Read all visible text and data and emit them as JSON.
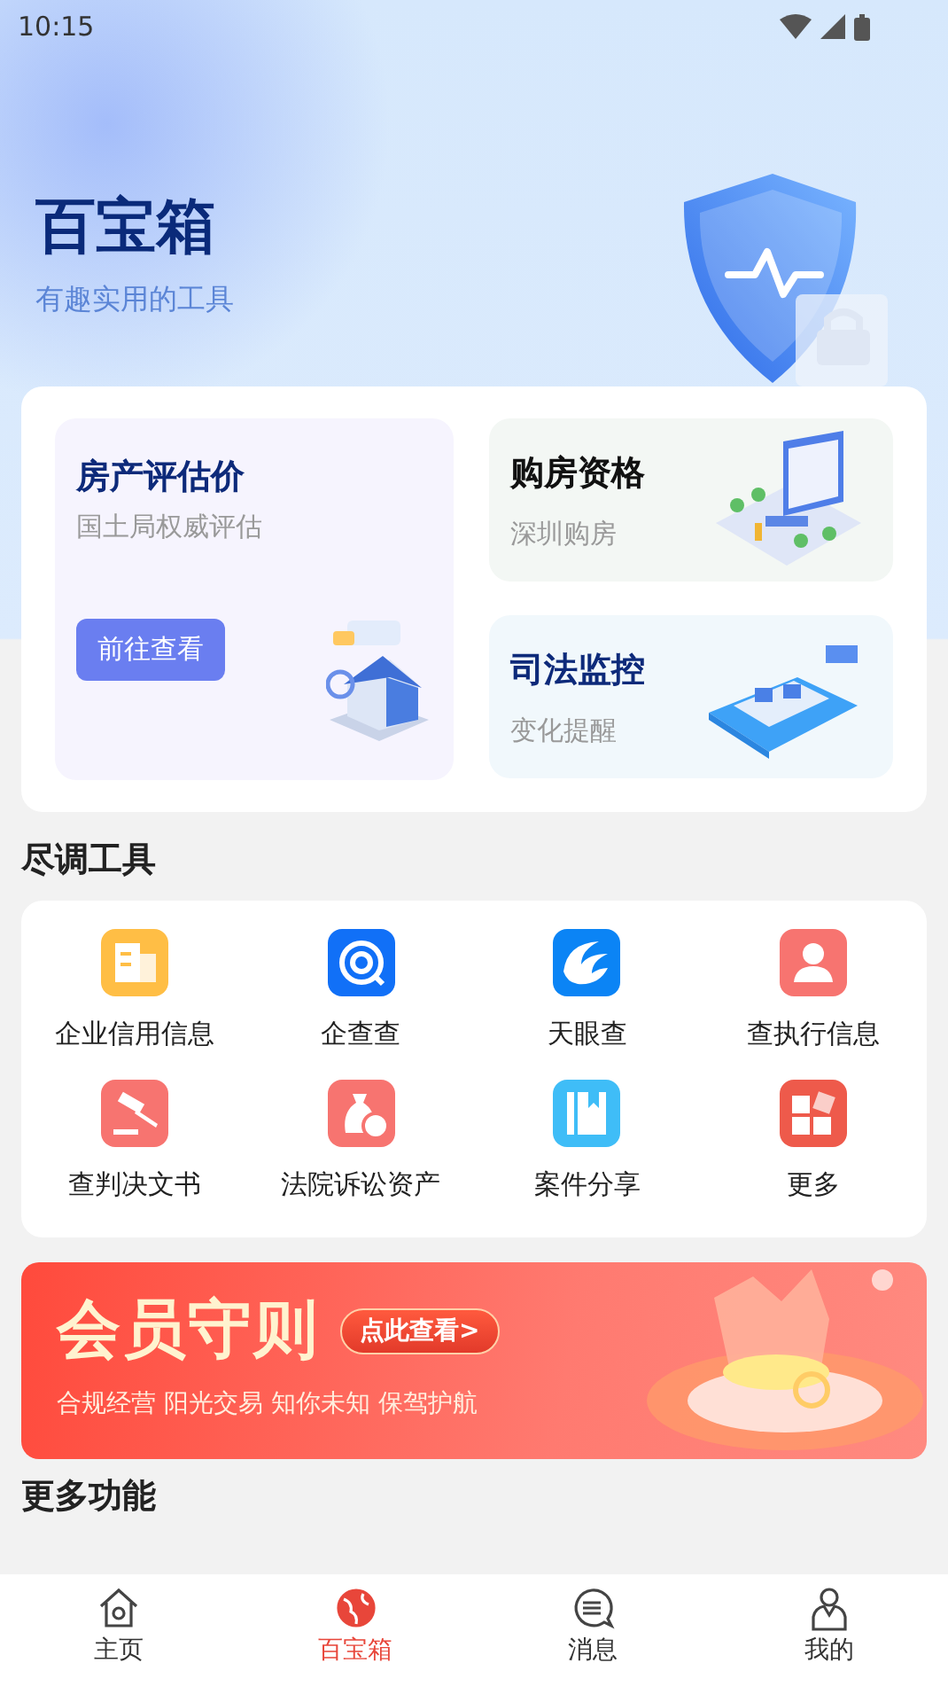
{
  "status_bar": {
    "time": "10:15"
  },
  "header": {
    "title": "百宝箱",
    "subtitle": "有趣实用的工具"
  },
  "feature_cards": [
    {
      "kind": "large",
      "title": "房产评估价",
      "subtitle": "国土局权威评估",
      "button": "前往查看"
    },
    {
      "kind": "small",
      "title": "购房资格",
      "subtitle": "深圳购房"
    },
    {
      "kind": "small",
      "title": "司法监控",
      "subtitle": "变化提醒"
    }
  ],
  "tools_section": {
    "title": "尽调工具"
  },
  "tools": [
    {
      "kind": "building",
      "label": "企业信用信息",
      "color": "#ffbe45"
    },
    {
      "kind": "magnifier",
      "label": "企查查",
      "color": "#1170f7"
    },
    {
      "kind": "eye",
      "label": "天眼查",
      "color": "#0b84f5"
    },
    {
      "kind": "person",
      "label": "查执行信息",
      "color": "#f77470"
    },
    {
      "kind": "gavel",
      "label": "查判决文书",
      "color": "#f77470"
    },
    {
      "kind": "moneybag",
      "label": "法院诉讼资产",
      "color": "#f77470"
    },
    {
      "kind": "book",
      "label": "案件分享",
      "color": "#3fbdf7"
    },
    {
      "kind": "grid",
      "label": "更多",
      "color": "#ee5a4b"
    }
  ],
  "banner": {
    "title": "会员守则",
    "button": "点此查看>",
    "slogan": "合规经营 阳光交易 知你未知 保驾护航"
  },
  "more_section": {
    "title": "更多功能"
  },
  "bottom_nav": [
    {
      "kind": "home",
      "label": "主页",
      "selected": false
    },
    {
      "kind": "globe",
      "label": "百宝箱",
      "selected": true
    },
    {
      "kind": "message",
      "label": "消息",
      "selected": false
    },
    {
      "kind": "user",
      "label": "我的",
      "selected": false
    }
  ]
}
